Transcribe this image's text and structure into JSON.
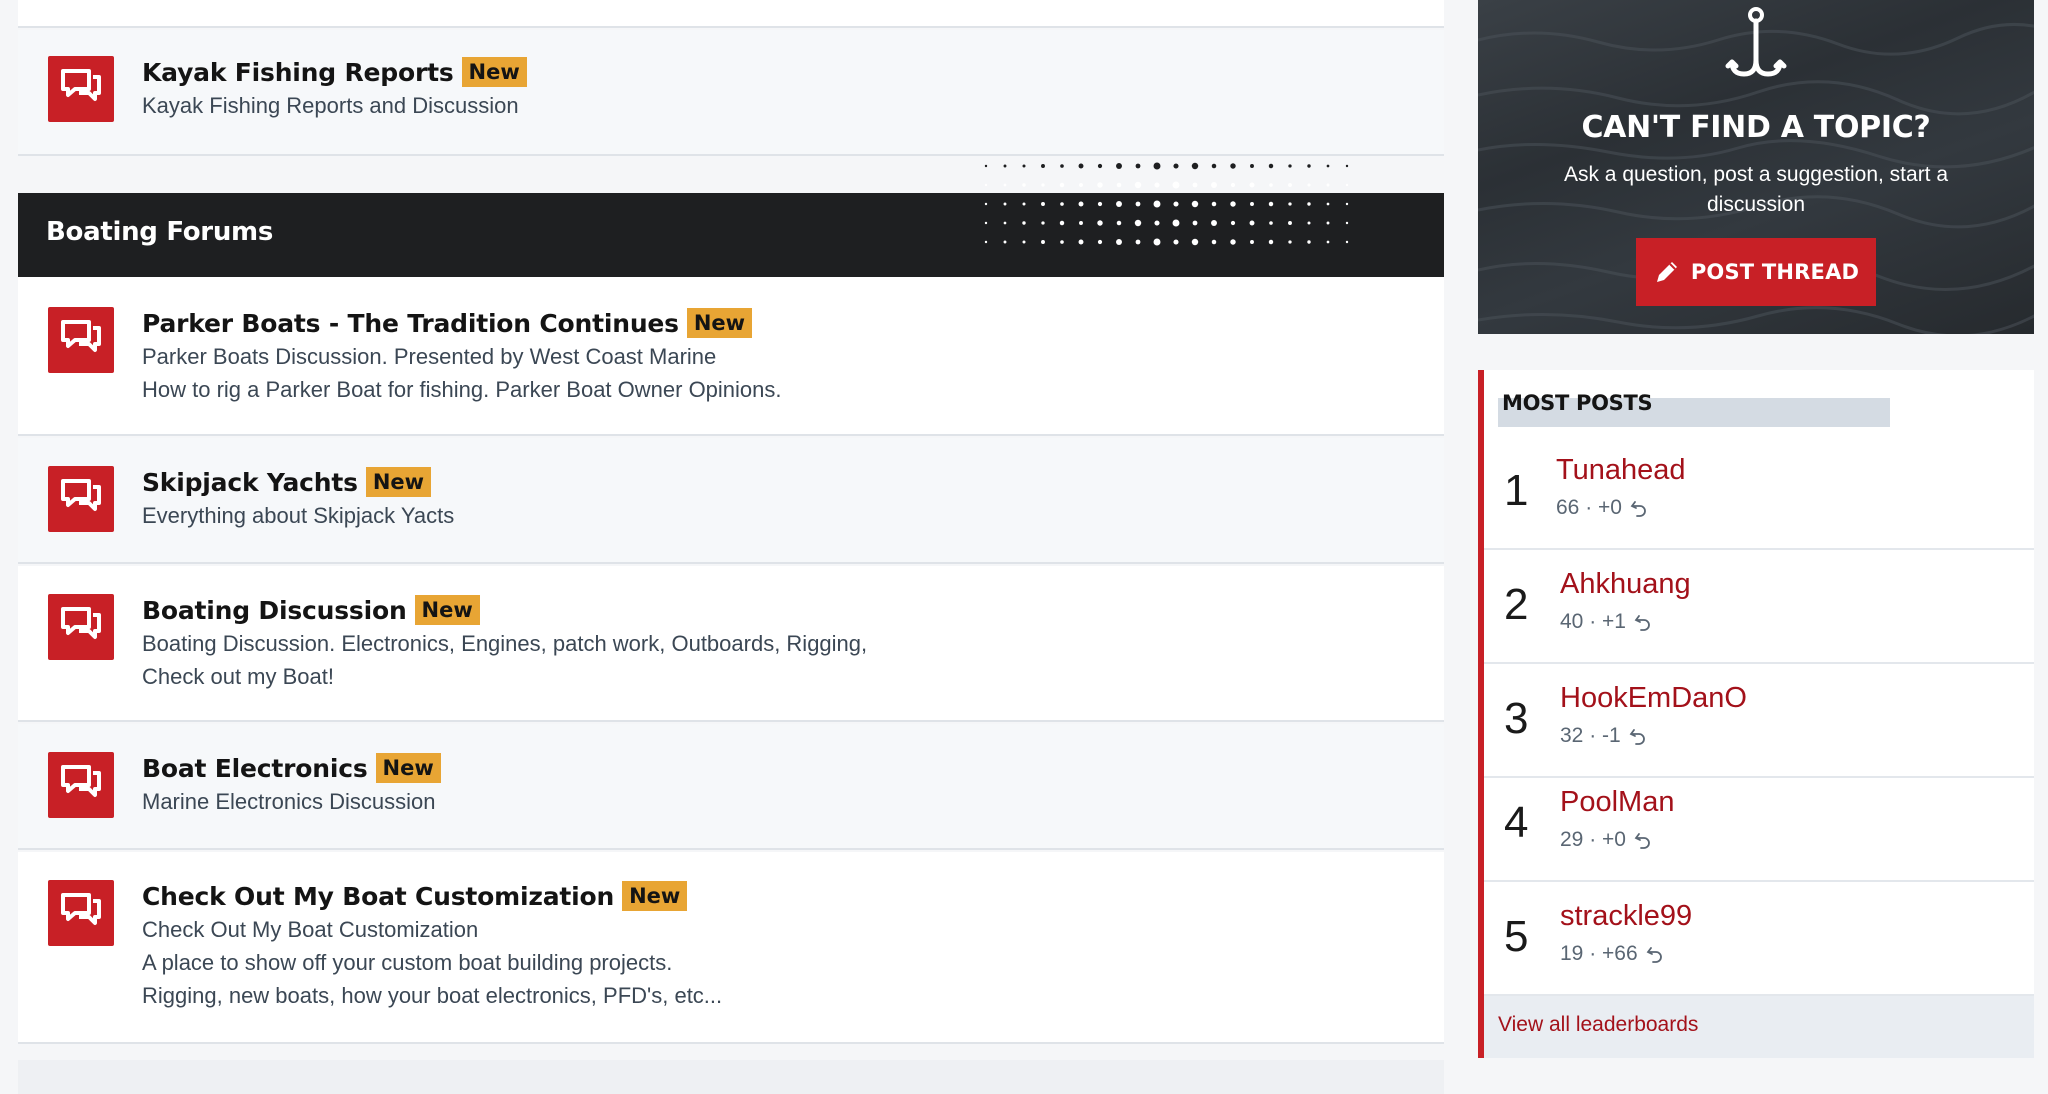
{
  "colors": {
    "brand_red": "#c82026",
    "badge_gold": "#e8a534",
    "dark_header": "#1e1f21",
    "link_red": "#a3111a"
  },
  "icons": {
    "forum_node": "chat-bubbles-icon",
    "cta": "fishing-hook-icon",
    "post": "pencil-icon",
    "reaction": "undo-arrow-icon"
  },
  "top_forum": {
    "title": "Kayak Fishing Reports",
    "badge": "New",
    "desc": [
      "Kayak Fishing Reports and Discussion"
    ]
  },
  "category": {
    "title": "Boating Forums",
    "forums": [
      {
        "title": "Parker Boats - The Tradition Continues",
        "badge": "New",
        "desc": [
          "Parker Boats Discussion. Presented by West Coast Marine",
          "How to rig a Parker Boat for fishing. Parker Boat Owner Opinions."
        ]
      },
      {
        "title": "Skipjack Yachts",
        "badge": "New",
        "desc": [
          "Everything about Skipjack Yacts"
        ]
      },
      {
        "title": "Boating Discussion",
        "badge": "New",
        "desc": [
          "Boating Discussion. Electronics, Engines, patch work, Outboards, Rigging,",
          "Check out my Boat!"
        ]
      },
      {
        "title": "Boat Electronics",
        "badge": "New",
        "desc": [
          "Marine Electronics Discussion"
        ]
      },
      {
        "title": "Check Out My Boat Customization",
        "badge": "New",
        "desc": [
          "Check Out My Boat Customization",
          "A place to show off your custom boat building projects.",
          "Rigging, new boats, how your boat electronics, PFD's, etc..."
        ]
      }
    ]
  },
  "cta": {
    "title": "CAN'T FIND A TOPIC?",
    "text": "Ask a question, post a suggestion, start a discussion",
    "button": "POST THREAD"
  },
  "leaderboard": {
    "title": "MOST POSTS",
    "entries": [
      {
        "rank": "1",
        "name": "Tunahead",
        "stats": "66 · +0"
      },
      {
        "rank": "2",
        "name": "Ahkhuang",
        "stats": "40 · +1"
      },
      {
        "rank": "3",
        "name": "HookEmDanO",
        "stats": "32 · -1"
      },
      {
        "rank": "4",
        "name": "PoolMan",
        "stats": "29 · +0"
      },
      {
        "rank": "5",
        "name": "strackle99",
        "stats": "19 · +66"
      }
    ],
    "footer_link": "View all leaderboards"
  }
}
